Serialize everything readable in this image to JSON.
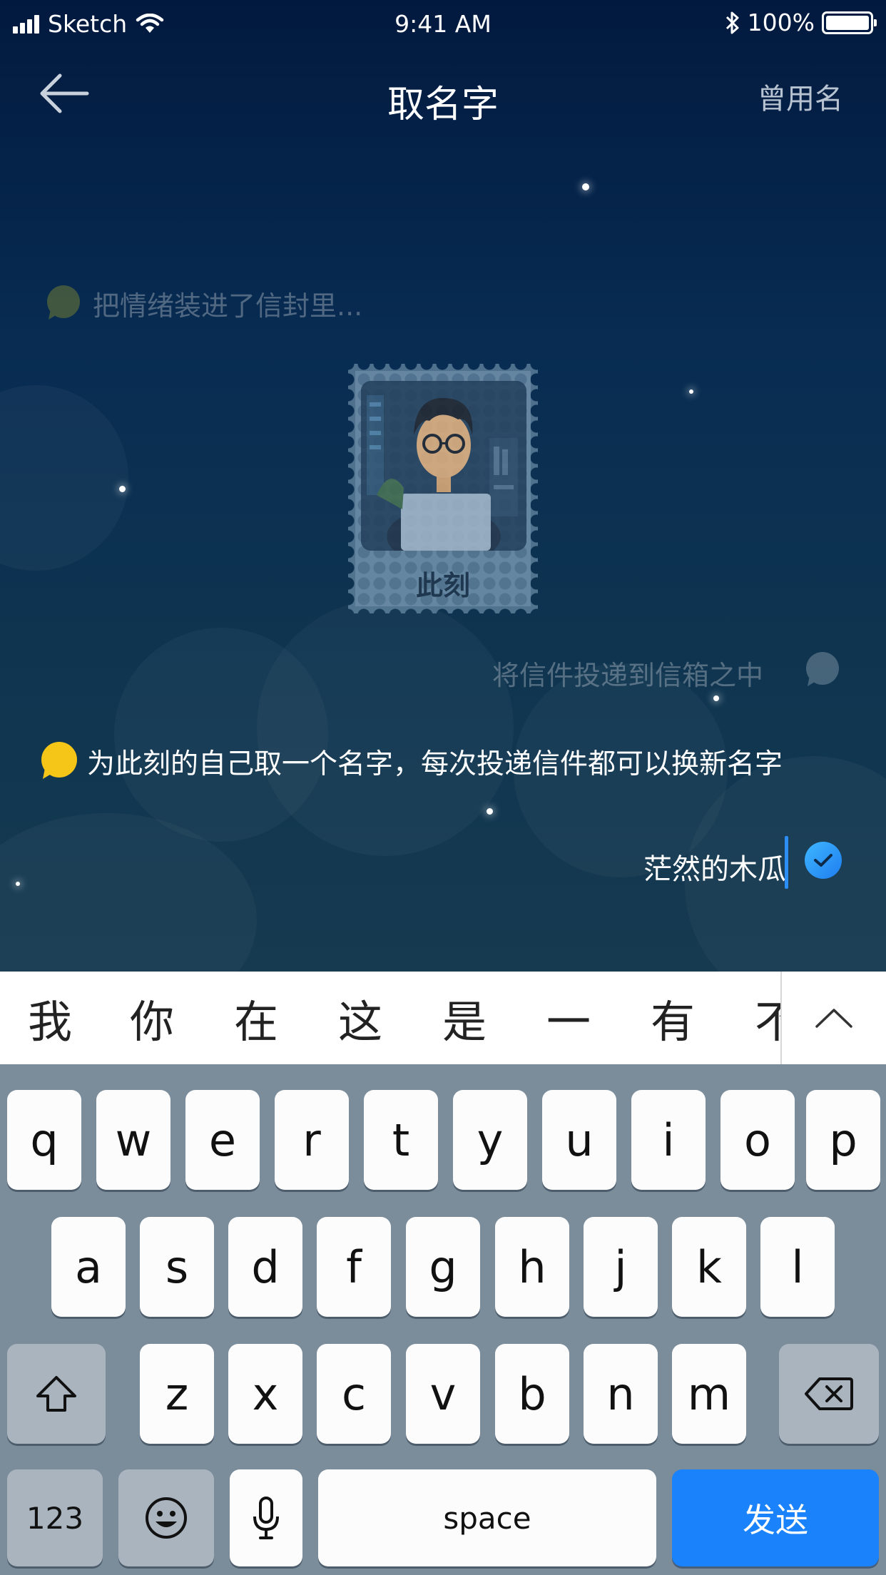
{
  "status_bar": {
    "carrier": "Sketch",
    "time": "9:41 AM",
    "battery": "100%"
  },
  "nav": {
    "title": "取名字",
    "right_label": "曾用名"
  },
  "messages": {
    "faded_left": "把情绪装进了信封里...",
    "faded_right": "将信件投递到信箱之中",
    "prompt": "为此刻的自己取一个名字，每次投递信件都可以换新名字"
  },
  "stamp": {
    "label": "此刻"
  },
  "name_input": {
    "value": "茫然的木瓜"
  },
  "candidates": [
    "我",
    "你",
    "在",
    "这",
    "是",
    "一",
    "有",
    "不"
  ],
  "keyboard": {
    "row1": [
      "q",
      "w",
      "e",
      "r",
      "t",
      "y",
      "u",
      "i",
      "o",
      "p"
    ],
    "row2": [
      "a",
      "s",
      "d",
      "f",
      "g",
      "h",
      "j",
      "k",
      "l"
    ],
    "row3": [
      "z",
      "x",
      "c",
      "v",
      "b",
      "n",
      "m"
    ],
    "num_label": "123",
    "space_label": "space",
    "send_label": "发送"
  },
  "colors": {
    "accent": "#1a82fb",
    "bubble_yellow": "#f5c518",
    "keyboard_bg": "#7b8c9a"
  }
}
